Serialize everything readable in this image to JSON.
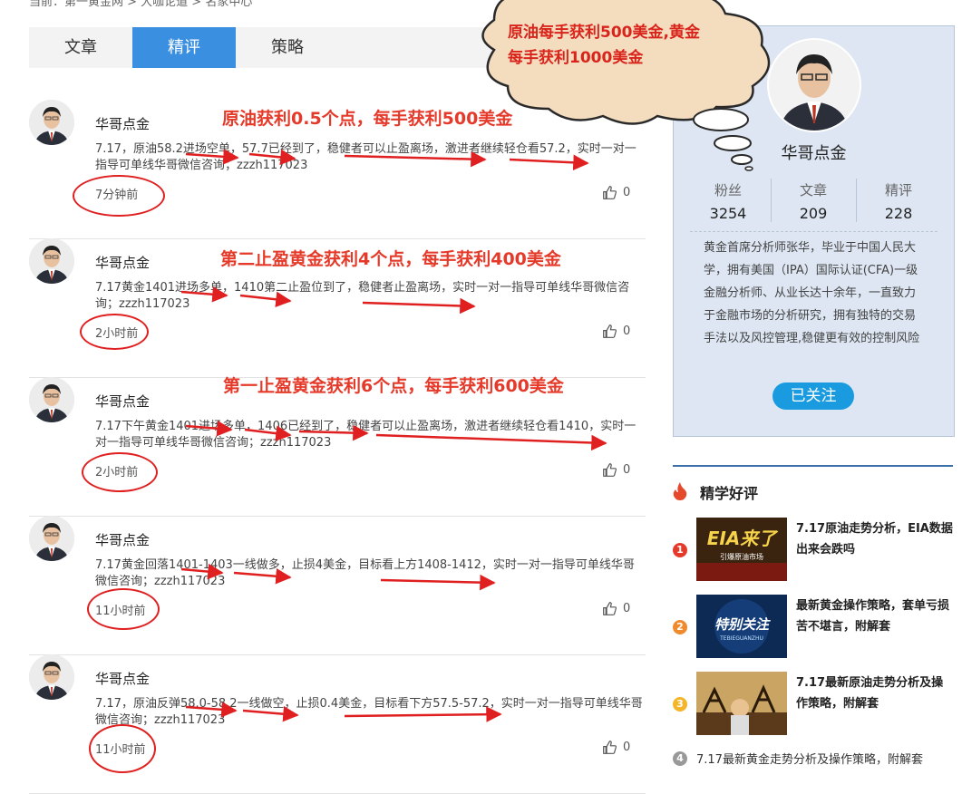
{
  "breadcrumb": "当前：第一黄金网 > 大咖论道 > 名家中心",
  "tabs": [
    {
      "label": "文章",
      "active": false
    },
    {
      "label": "精评",
      "active": true
    },
    {
      "label": "策略",
      "active": false
    }
  ],
  "cloud_note": [
    "原油每手获利500美金,黄金",
    "每手获利1000美金"
  ],
  "posts": [
    {
      "author": "华哥点金",
      "content": "7.17，原油58.2进场空单，57.7已经到了，稳健者可以止盈离场，激进者继续轻仓看57.2，实时一对一指导可单线华哥微信咨询；zzzh117023",
      "time": "7分钟前",
      "likes": "0",
      "annotation": "原油获利0.5个点，每手获利500美金"
    },
    {
      "author": "华哥点金",
      "content": "7.17黄金1401进场多单，1410第二止盈位到了，稳健者止盈离场，实时一对一指导可单线华哥微信咨询；zzzh117023",
      "time": "2小时前",
      "likes": "0",
      "annotation": "第二止盈黄金获利4个点，每手获利400美金"
    },
    {
      "author": "华哥点金",
      "content": "7.17下午黄金1401进场多单，1406已经到了，稳健者可以止盈离场，激进者继续轻仓看1410，实时一对一指导可单线华哥微信咨询；zzzh117023",
      "time": "2小时前",
      "likes": "0",
      "annotation": "第一止盈黄金获利6个点，每手获利600美金"
    },
    {
      "author": "华哥点金",
      "content": "7.17黄金回落1401-1403一线做多，止损4美金，目标看上方1408-1412，实时一对一指导可单线华哥微信咨询；zzzh117023",
      "time": "11小时前",
      "likes": "0",
      "annotation": ""
    },
    {
      "author": "华哥点金",
      "content": "7.17，原油反弹58.0-58.2一线做空，止损0.4美金，目标看下方57.5-57.2，实时一对一指导可单线华哥微信咨询；zzzh117023",
      "time": "11小时前",
      "likes": "0",
      "annotation": ""
    }
  ],
  "profile": {
    "name": "华哥点金",
    "stats": [
      {
        "label": "粉丝",
        "value": "3254"
      },
      {
        "label": "文章",
        "value": "209"
      },
      {
        "label": "精评",
        "value": "228"
      }
    ],
    "bio": "黄金首席分析师张华，毕业于中国人民大学，拥有美国（IPA）国际认证(CFA)一级金融分析师、从业长达十余年，一直致力于金融市场的分析研究，拥有独特的交易手法以及风控管理,稳健更有效的控制风险",
    "follow_label": "已关注"
  },
  "best": {
    "title": "精学好评",
    "items": [
      {
        "rank": "1",
        "title": "7.17原油走势分析，EIA数据出来会跌吗",
        "thumb_text": "EIA来了",
        "thumb_sub": "引爆原油市场"
      },
      {
        "rank": "2",
        "title": "最新黄金操作策略，套单亏损苦不堪言，附解套",
        "thumb_text": "特别关注",
        "thumb_sub": "TEBIEGUANZHU"
      },
      {
        "rank": "3",
        "title": "7.17最新原油走势分析及操作策略，附解套",
        "thumb_text": "",
        "thumb_sub": ""
      },
      {
        "rank": "4",
        "title": "7.17最新黄金走势分析及操作策略，附解套",
        "thumb_text": "",
        "thumb_sub": ""
      }
    ]
  },
  "colors": {
    "accent": "#3b8fe0",
    "annotation": "#e53a2a",
    "follow": "#1a9be0"
  }
}
